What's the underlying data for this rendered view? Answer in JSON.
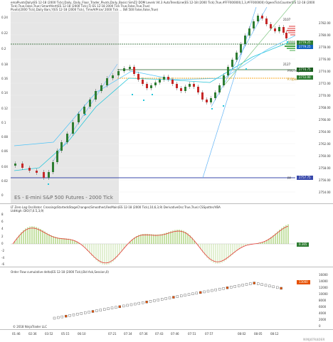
{
  "main": {
    "header_lines": [
      "emaPivotsDaily(ES 12-18 (2000 Tick),Daily, Daily_Floor_Trader_Pivots,Daily_Basis)  SimZ2 DOM Levels V4.3  AutoTrendLine(ES 12-18 (2000 Tick),True,#FFF000000,1,3,#FF000000)  OgeesTickCounter(ES 12-18 (2000",
      "Tick),True,False,True)  SmartAlert(ES 12-18 (2000 Tick),5)  ES 12-18 2000 Tick  True,False,True,True)",
      "Pivots(2000 Tick),Daily Bars,Y(ES 12-18 (2000 Tick),  TimeAtPrice/ 2000 Tick ...  SW  500 False,False,True)"
    ],
    "left_ticks": [
      "0.24",
      "0.22",
      "0.2",
      "0.18",
      "0.16",
      "0.14",
      "0.12",
      "0.1",
      "0.08",
      "0.06",
      "0.04",
      "0.02",
      "0"
    ],
    "right_ticks": [
      "2782.00",
      "2780.00",
      "2778.00",
      "2776.00",
      "2774.00",
      "2772.00",
      "2770.00",
      "2768.00",
      "2766.00",
      "2764.00",
      "2762.00",
      "2760.00",
      "2758.00",
      "2756.00",
      "2754.00"
    ],
    "price_tags": [
      {
        "text": "2779.25",
        "color": "#2e7d32"
      },
      {
        "text": "2779.25",
        "color": "#1565c0"
      },
      {
        "text": "2774.75",
        "color": "#1b5e20"
      },
      {
        "text": "2772.00",
        "color": "#2e7d32"
      },
      {
        "text": "2757.75",
        "color": "#3949ab"
      }
    ],
    "annotations": {
      "a2107": "2107",
      "a1580": "1580",
      "a2127": "2127",
      "pivot_high": "Prev High",
      "pivot_mid": "R Open",
      "pp": "pp"
    },
    "watermark": "ES - E-mini S&P 500 Futures - 2000 Tick"
  },
  "oscillator": {
    "header_lines": [
      "LT Zero Lag Oscillator: CrossingsStartedsStageChanges(Smoothed,ResMain(ES 12-18 (2000 Tick),10,6,3,9) DerivativeOsc:True,True)  CSSpotter/VBA",
      "LtdHigh: DIO(7,6.5,3,9)"
    ],
    "left_ticks": [
      "8",
      "6",
      "4",
      "2",
      "0",
      "-2",
      "-4",
      "-6"
    ],
    "value_tag": {
      "text": "0.365",
      "color": "#2e7d32"
    }
  },
  "orderflow": {
    "header": "Order Flow cumulative delta(ES 12-18 (2000 Tick),Bid Ask,Session,0)",
    "right_ticks": [
      "16000",
      "14000",
      "12000",
      "10000",
      "8000",
      "6000",
      "4000",
      "2000",
      "0"
    ],
    "value_tag": {
      "text": "13000",
      "color": "#e65100"
    }
  },
  "xaxis": {
    "labels": [
      "01:46",
      "02:36",
      "03:52",
      "05:15",
      "06:10",
      "07:21",
      "07:34",
      "07:36",
      "07:43",
      "07:46",
      "07:51",
      "07:57",
      "08:02",
      "08:05",
      "08:12"
    ]
  },
  "footer": {
    "copyright": "© 2018 NinjaTrader LLC",
    "brand": "NINJATRADER"
  },
  "colors": {
    "up": "#2e7d32",
    "down": "#c62828",
    "pivot_cyan": "#26c6da",
    "gold": "#f9a825",
    "session_shade": "#e0e0e0"
  }
}
